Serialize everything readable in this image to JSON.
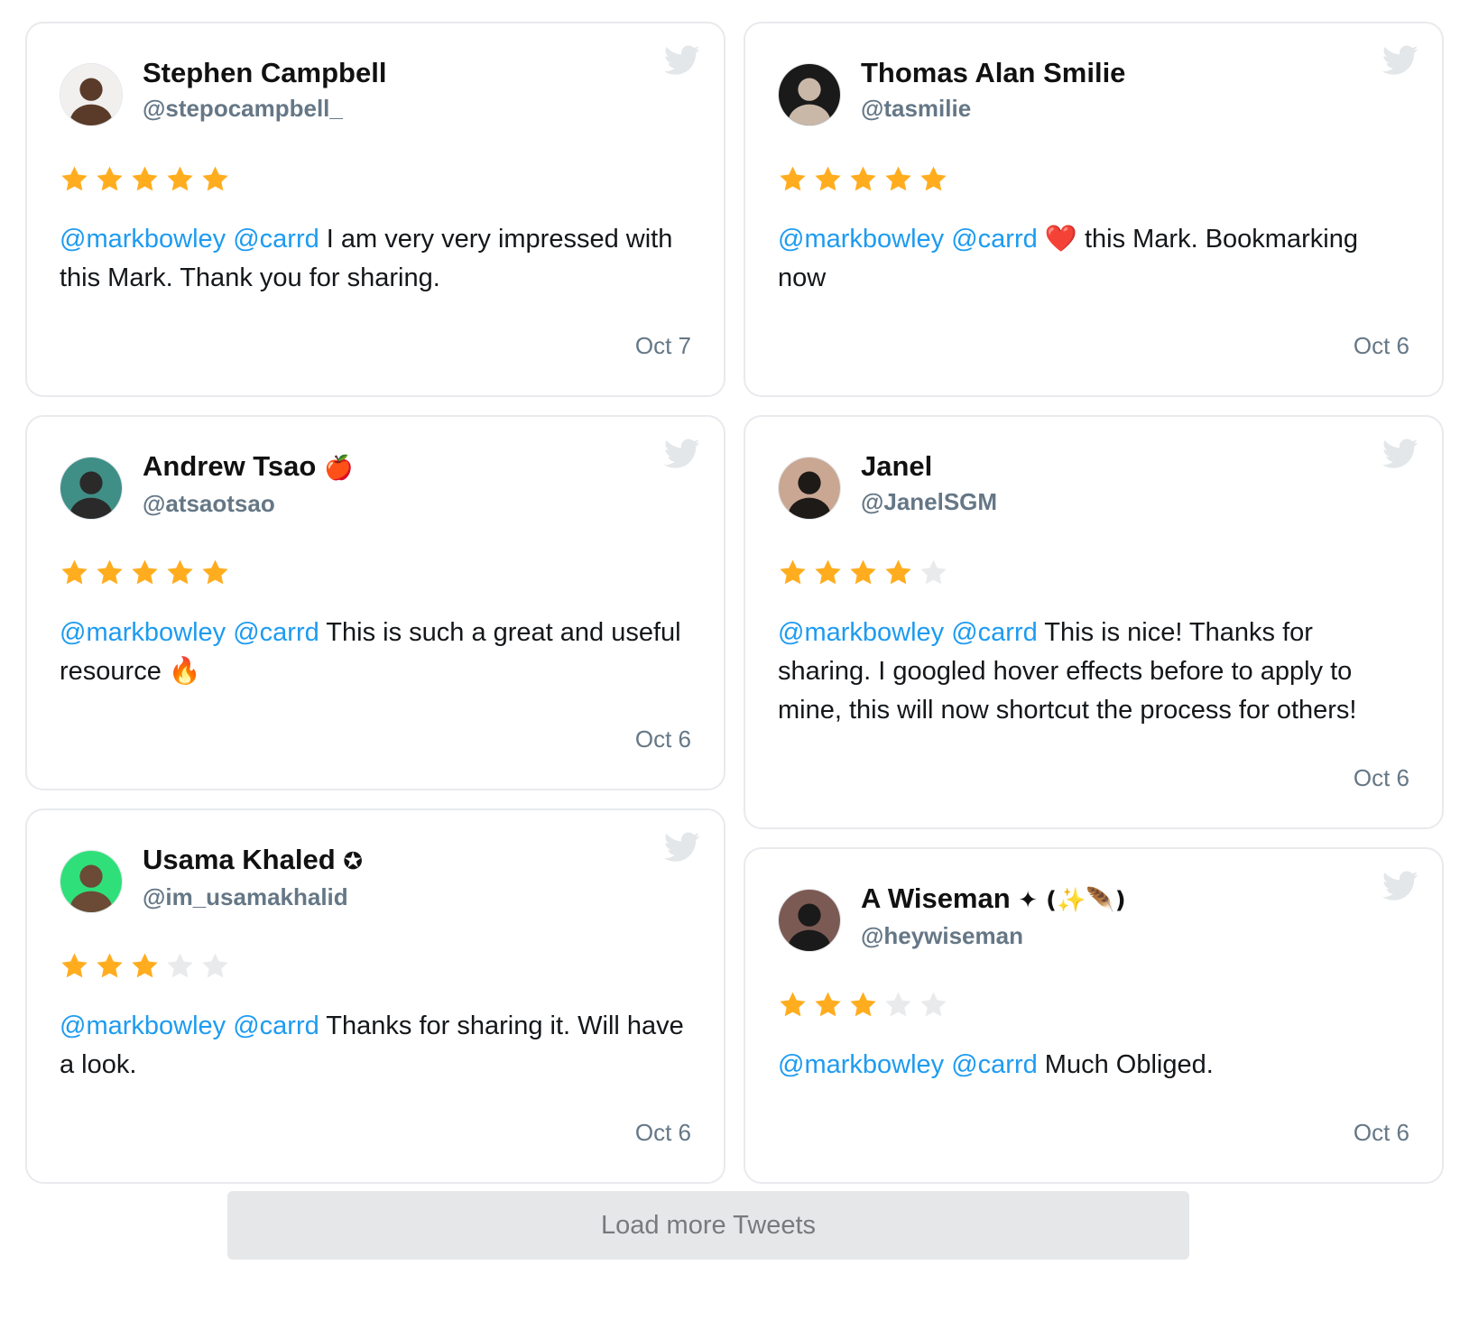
{
  "colors": {
    "mention": "#1d9bf0",
    "star_on": "#ffad1f",
    "star_off": "#e9eaec",
    "twitter_icon": "#e3e7ea",
    "handle": "#657786"
  },
  "columns": [
    [
      {
        "name": "Stephen Campbell",
        "name_emoji": "",
        "handle": "@stepocampbell_",
        "rating": 5,
        "mentions": [
          "@markbowley",
          "@carrd"
        ],
        "text": "I am very very impressed with this Mark. Thank you for sharing.",
        "date": "Oct 7",
        "avatar": {
          "bg": "#f1f0ee",
          "fg": "#5a3b2a"
        }
      },
      {
        "name": "Andrew Tsao",
        "name_emoji": "🍎",
        "handle": "@atsaotsao",
        "rating": 5,
        "mentions": [
          "@markbowley",
          "@carrd"
        ],
        "text": "This is such a great and useful resource 🔥",
        "date": "Oct 6",
        "avatar": {
          "bg": "#3f8f86",
          "fg": "#2a2a2a"
        }
      },
      {
        "name": "Usama Khaled",
        "name_emoji": "✪",
        "handle": "@im_usamakhalid",
        "rating": 3,
        "mentions": [
          "@markbowley",
          "@carrd"
        ],
        "text": "Thanks for sharing it. Will have a look.",
        "date": "Oct 6",
        "avatar": {
          "bg": "#2fe07a",
          "fg": "#6b4a36"
        }
      }
    ],
    [
      {
        "name": "Thomas Alan Smilie",
        "name_emoji": "",
        "handle": "@tasmilie",
        "rating": 5,
        "mentions": [
          "@markbowley",
          "@carrd"
        ],
        "text": "❤️ this Mark. Bookmarking now",
        "date": "Oct 6",
        "avatar": {
          "bg": "#1a1a1a",
          "fg": "#c9b8a8"
        }
      },
      {
        "name": "Janel",
        "name_emoji": "",
        "handle": "@JanelSGM",
        "rating": 4,
        "mentions": [
          "@markbowley",
          "@carrd"
        ],
        "text": "This is nice! Thanks for sharing. I googled hover effects before to apply to mine, this will now shortcut the process for others!",
        "date": "Oct 6",
        "avatar": {
          "bg": "#c9a793",
          "fg": "#1e1a18"
        }
      },
      {
        "name": "A Wiseman",
        "name_emoji": "✦ (✨🪶)",
        "handle": "@heywiseman",
        "rating": 3,
        "mentions": [
          "@markbowley",
          "@carrd"
        ],
        "text": "Much Obliged.",
        "date": "Oct 6",
        "avatar": {
          "bg": "#7c5a54",
          "fg": "#1a1a1a"
        }
      }
    ]
  ],
  "load_more_label": "Load more Tweets"
}
